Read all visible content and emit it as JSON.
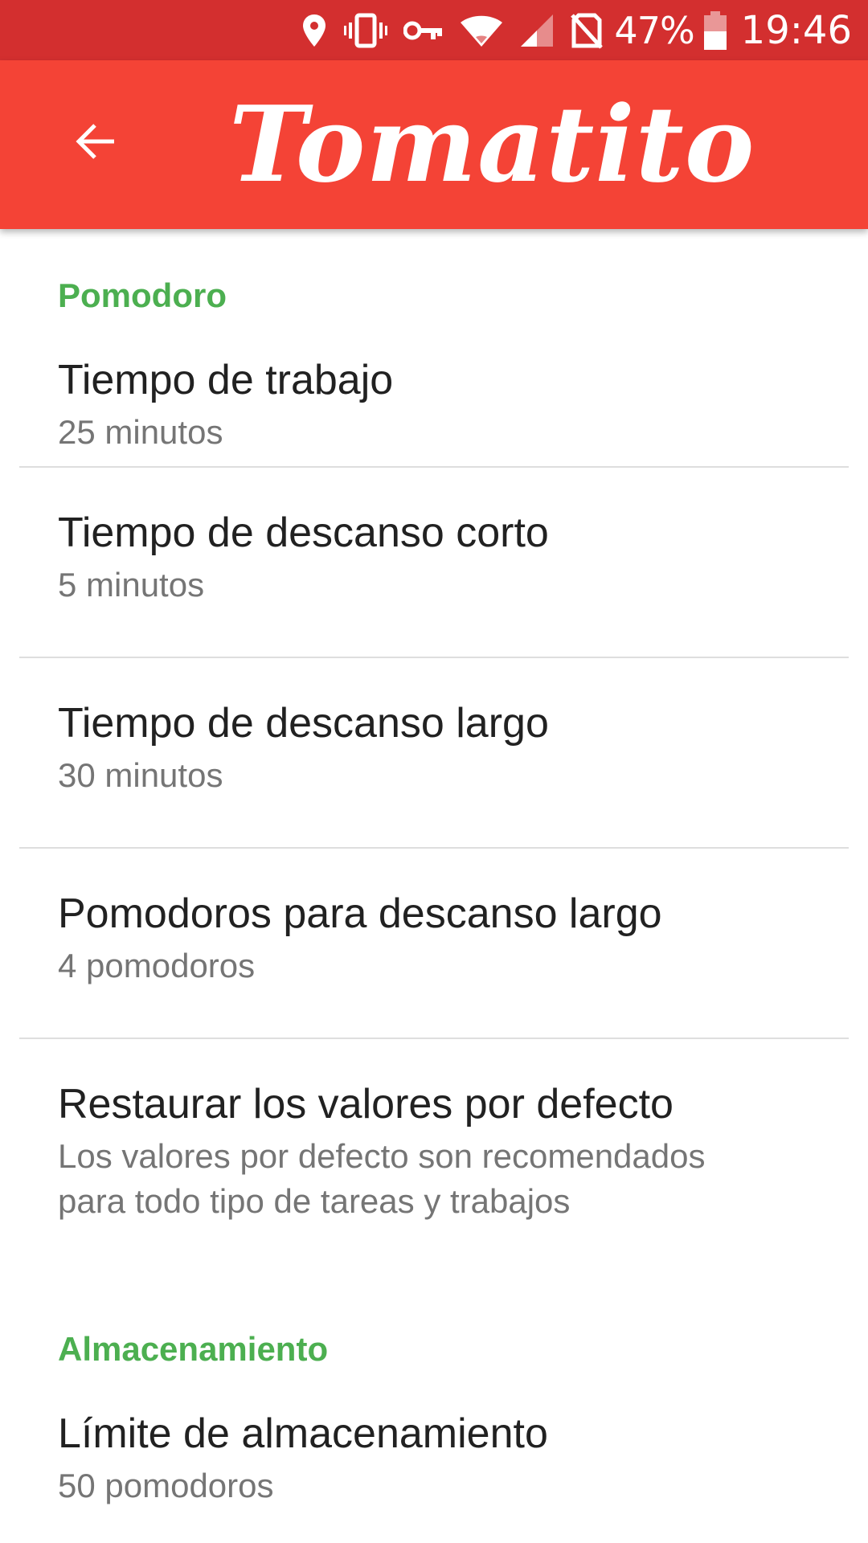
{
  "status_bar": {
    "battery_percent": "47%",
    "time": "19:46",
    "icons": [
      "location-icon",
      "vibrate-icon",
      "vpn-key-icon",
      "wifi-icon",
      "signal-icon",
      "no-sim-icon",
      "battery-icon"
    ],
    "battery_level": 0.47
  },
  "app_bar": {
    "title": "Tomatito",
    "back_icon": "arrow-back-icon",
    "color": "#f44336"
  },
  "sections": {
    "pomodoro": {
      "header": "Pomodoro",
      "items": [
        {
          "title": "Tiempo de trabajo",
          "summary": "25 minutos"
        },
        {
          "title": "Tiempo de descanso corto",
          "summary": "5 minutos"
        },
        {
          "title": "Tiempo de descanso largo",
          "summary": "30 minutos"
        },
        {
          "title": "Pomodoros para descanso largo",
          "summary": "4 pomodoros"
        },
        {
          "title": "Restaurar los valores por defecto",
          "summary_line1": "Los valores por defecto son recomendados",
          "summary_line2": "para todo tipo de tareas y trabajos"
        }
      ]
    },
    "storage": {
      "header": "Almacenamiento",
      "items": [
        {
          "title": "Límite de almacenamiento",
          "summary": "50 pomodoros"
        }
      ]
    }
  },
  "colors": {
    "status_bar": "#d32f2f",
    "accent_green": "#4caf50"
  }
}
